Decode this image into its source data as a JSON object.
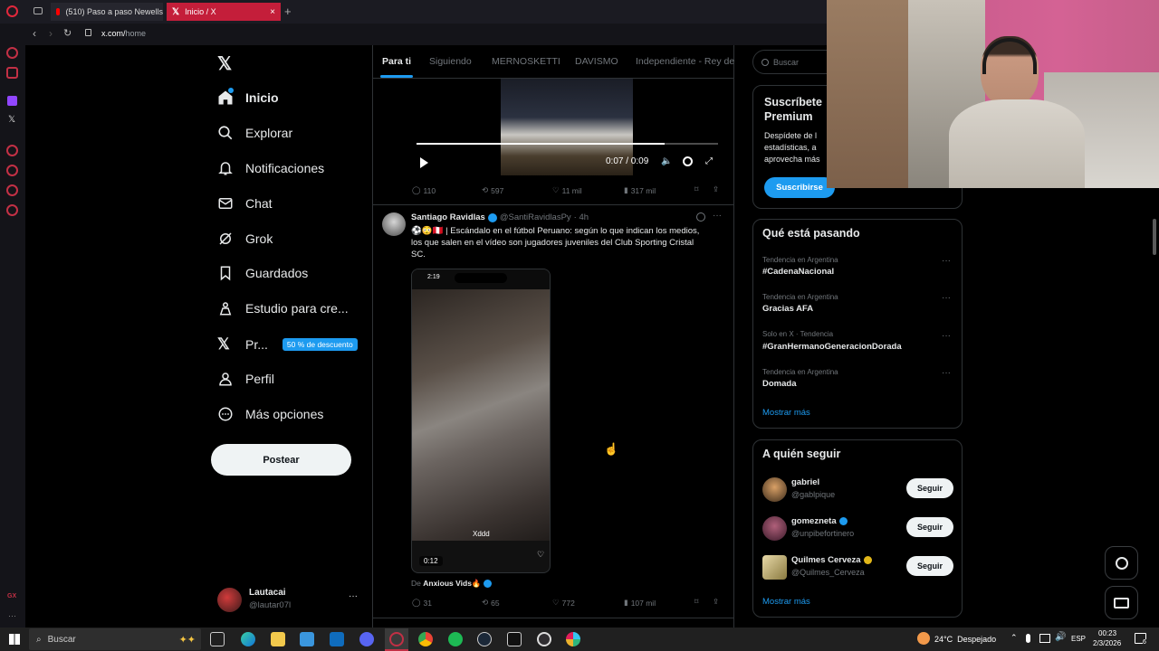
{
  "browser": {
    "tabs": [
      {
        "label": "(510) Paso a paso Newells"
      },
      {
        "label": "Inicio / X"
      }
    ],
    "url_host": "x.com/",
    "url_path": "home"
  },
  "nav": {
    "items": [
      {
        "label": "Inicio"
      },
      {
        "label": "Explorar"
      },
      {
        "label": "Notificaciones"
      },
      {
        "label": "Chat"
      },
      {
        "label": "Grok"
      },
      {
        "label": "Guardados"
      },
      {
        "label": "Estudio para cre..."
      },
      {
        "label": "Pr..."
      },
      {
        "label": "Perfil"
      },
      {
        "label": "Más opciones"
      }
    ],
    "premium_badge": "50 % de descuento",
    "post_button": "Postear",
    "account_name": "Lautacai",
    "account_handle": "@lautar07l"
  },
  "timeline": {
    "tabs": [
      "Para ti",
      "Siguiendo",
      "MERNOSKETTI",
      "DAVISMO",
      "Independiente - Rey de"
    ],
    "video1": {
      "time": "0:07 / 0:09"
    },
    "post1_stats": {
      "replies": "110",
      "reposts": "597",
      "likes": "11 mil",
      "views": "317 mil"
    },
    "post2": {
      "author": "Santiago Ravidlas",
      "handle": "@SantiRavidlasPy",
      "time": "· 4h",
      "text_line1": "⚽😳🇵🇪 | Escándalo en el fútbol Peruano: según lo que indican los medios,",
      "text_line2": "los que salen en el vídeo son jugadores juveniles del Club Sporting Cristal",
      "text_line3": "SC.",
      "video_clock": "2:19",
      "video_caption": "Xddd",
      "video_time": "0:12",
      "source_prefix": "De ",
      "source_name": "Anxious Vids🔥",
      "stats": {
        "replies": "31",
        "reposts": "65",
        "likes": "772",
        "views": "107 mil"
      }
    }
  },
  "sidebar": {
    "search_placeholder": "Buscar",
    "premium_title_1": "Suscríbete",
    "premium_title_2": "Premium",
    "premium_text_1": "Despídete de l",
    "premium_text_2": "estadísticas, a",
    "premium_text_3": "aprovecha más",
    "subscribe_button": "Suscribirse",
    "trends_title": "Qué está pasando",
    "trends": [
      {
        "context": "Tendencia en Argentina",
        "name": "#CadenaNacional"
      },
      {
        "context": "Tendencia en Argentina",
        "name": "Gracias AFA"
      },
      {
        "context": "Solo en X · Tendencia",
        "name": "#GranHermanoGeneracionDorada"
      },
      {
        "context": "Tendencia en Argentina",
        "name": "Domada"
      }
    ],
    "show_more": "Mostrar más",
    "who_to_follow_title": "A quién seguir",
    "follow": [
      {
        "name": "gabriel",
        "handle": "@gablpique",
        "button": "Seguir"
      },
      {
        "name": "gomezneta",
        "handle": "@unpibefortinero",
        "button": "Seguir"
      },
      {
        "name": "Quilmes Cerveza",
        "handle": "@Quilmes_Cerveza",
        "button": "Seguir"
      }
    ],
    "show_more_2": "Mostrar más"
  },
  "taskbar": {
    "search": "Buscar",
    "weather": "24°C  Despejado",
    "lang": "ESP",
    "time": "00:23",
    "date": "2/3/2026",
    "notif_count": "6"
  },
  "colors": {
    "accent": "#1d9bf0",
    "opera_red": "#c23045",
    "tab_active": "#c41e3a"
  }
}
